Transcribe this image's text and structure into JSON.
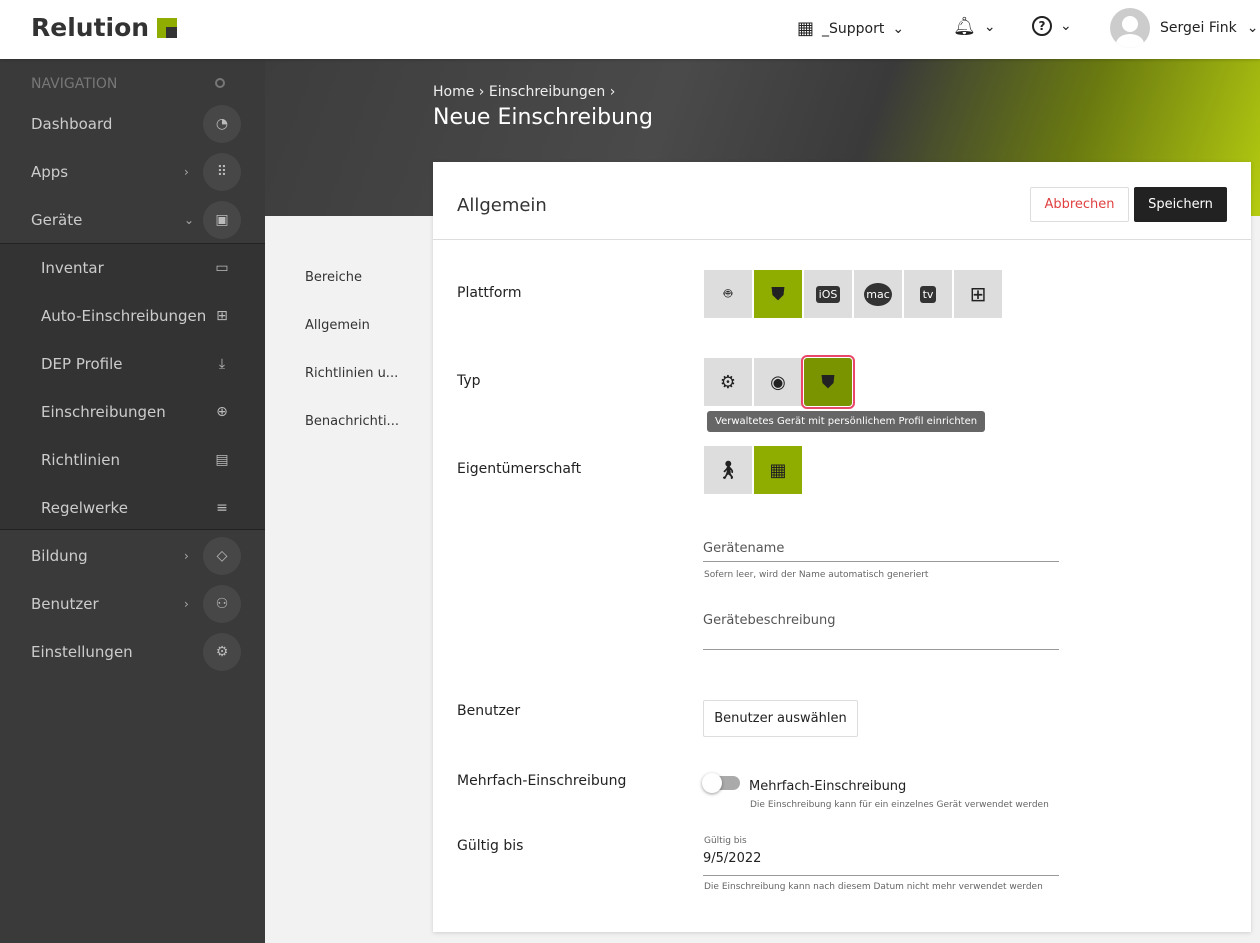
{
  "header": {
    "logo": "Relution",
    "org": "_Support",
    "user": "Sergei Fink"
  },
  "sidebar": {
    "heading": "NAVIGATION",
    "items": [
      {
        "label": "Dashboard",
        "icon": "◔"
      },
      {
        "label": "Apps",
        "icon": "⠿"
      },
      {
        "label": "Geräte",
        "icon": "▣"
      },
      {
        "label": "Inventar",
        "icon": "▭"
      },
      {
        "label": "Auto-Einschreibungen",
        "icon": "⊞"
      },
      {
        "label": "DEP Profile",
        "icon": "⤓"
      },
      {
        "label": "Einschreibungen",
        "icon": "⊕"
      },
      {
        "label": "Richtlinien",
        "icon": "▤"
      },
      {
        "label": "Regelwerke",
        "icon": "≡"
      },
      {
        "label": "Bildung",
        "icon": "◇"
      },
      {
        "label": "Benutzer",
        "icon": "⚇"
      },
      {
        "label": "Einstellungen",
        "icon": "⚙"
      }
    ]
  },
  "breadcrumb": [
    "Home",
    "Einschreibungen"
  ],
  "page_title": "Neue Einschreibung",
  "subnav": [
    "Bereiche",
    "Allgemein",
    "Richtlinien u...",
    "Benachrichti..."
  ],
  "card": {
    "title": "Allgemein",
    "cancel": "Abbrechen",
    "save": "Speichern",
    "platform_label": "Plattform",
    "platforms": [
      "android",
      "android-enterprise",
      "iOS",
      "mac",
      "tv",
      "windows"
    ],
    "platform_selected": "android-enterprise",
    "type_label": "Typ",
    "types": [
      "managed-device",
      "work-profile",
      "managed-device-personal-profile"
    ],
    "type_selected": "managed-device-personal-profile",
    "type_tooltip": "Verwaltetes Gerät mit persönlichem Profil einrichten",
    "ownership_label": "Eigentümerschaft",
    "ownership_selected": "company",
    "device_name_placeholder": "Gerätename",
    "device_name_hint": "Sofern leer, wird der Name automatisch generiert",
    "device_desc_placeholder": "Gerätebeschreibung",
    "user_label": "Benutzer",
    "user_button": "Benutzer auswählen",
    "multi_label": "Mehrfach-Einschreibung",
    "multi_toggle_label": "Mehrfach-Einschreibung",
    "multi_toggle_on": false,
    "multi_hint": "Die Einschreibung kann für ein einzelnes Gerät verwendet werden",
    "valid_label": "Gültig bis",
    "valid_field_label": "Gültig bis",
    "valid_value": "9/5/2022",
    "valid_hint": "Die Einschreibung kann nach diesem Datum nicht mehr verwendet werden"
  },
  "colors": {
    "accent": "#8fad00",
    "danger": "#e8476a"
  }
}
